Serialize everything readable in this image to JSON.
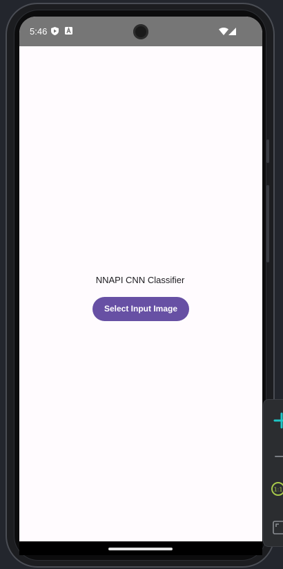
{
  "status_bar": {
    "time": "5:46",
    "left_icons": [
      "shield-play-icon",
      "a-letter-icon"
    ],
    "right_icons": [
      "wifi-icon",
      "cell-signal-icon"
    ],
    "background": "#767676"
  },
  "app": {
    "title": "NNAPI CNN Classifier",
    "select_button_label": "Select Input Image",
    "background": "#fffbfe",
    "accent": "#6750a4"
  },
  "emulator_toolbar": {
    "icons": [
      "zoom-in-icon",
      "zoom-out-icon",
      "actual-size-icon",
      "snapshot-icon"
    ],
    "accent": "#1fc6c6"
  }
}
